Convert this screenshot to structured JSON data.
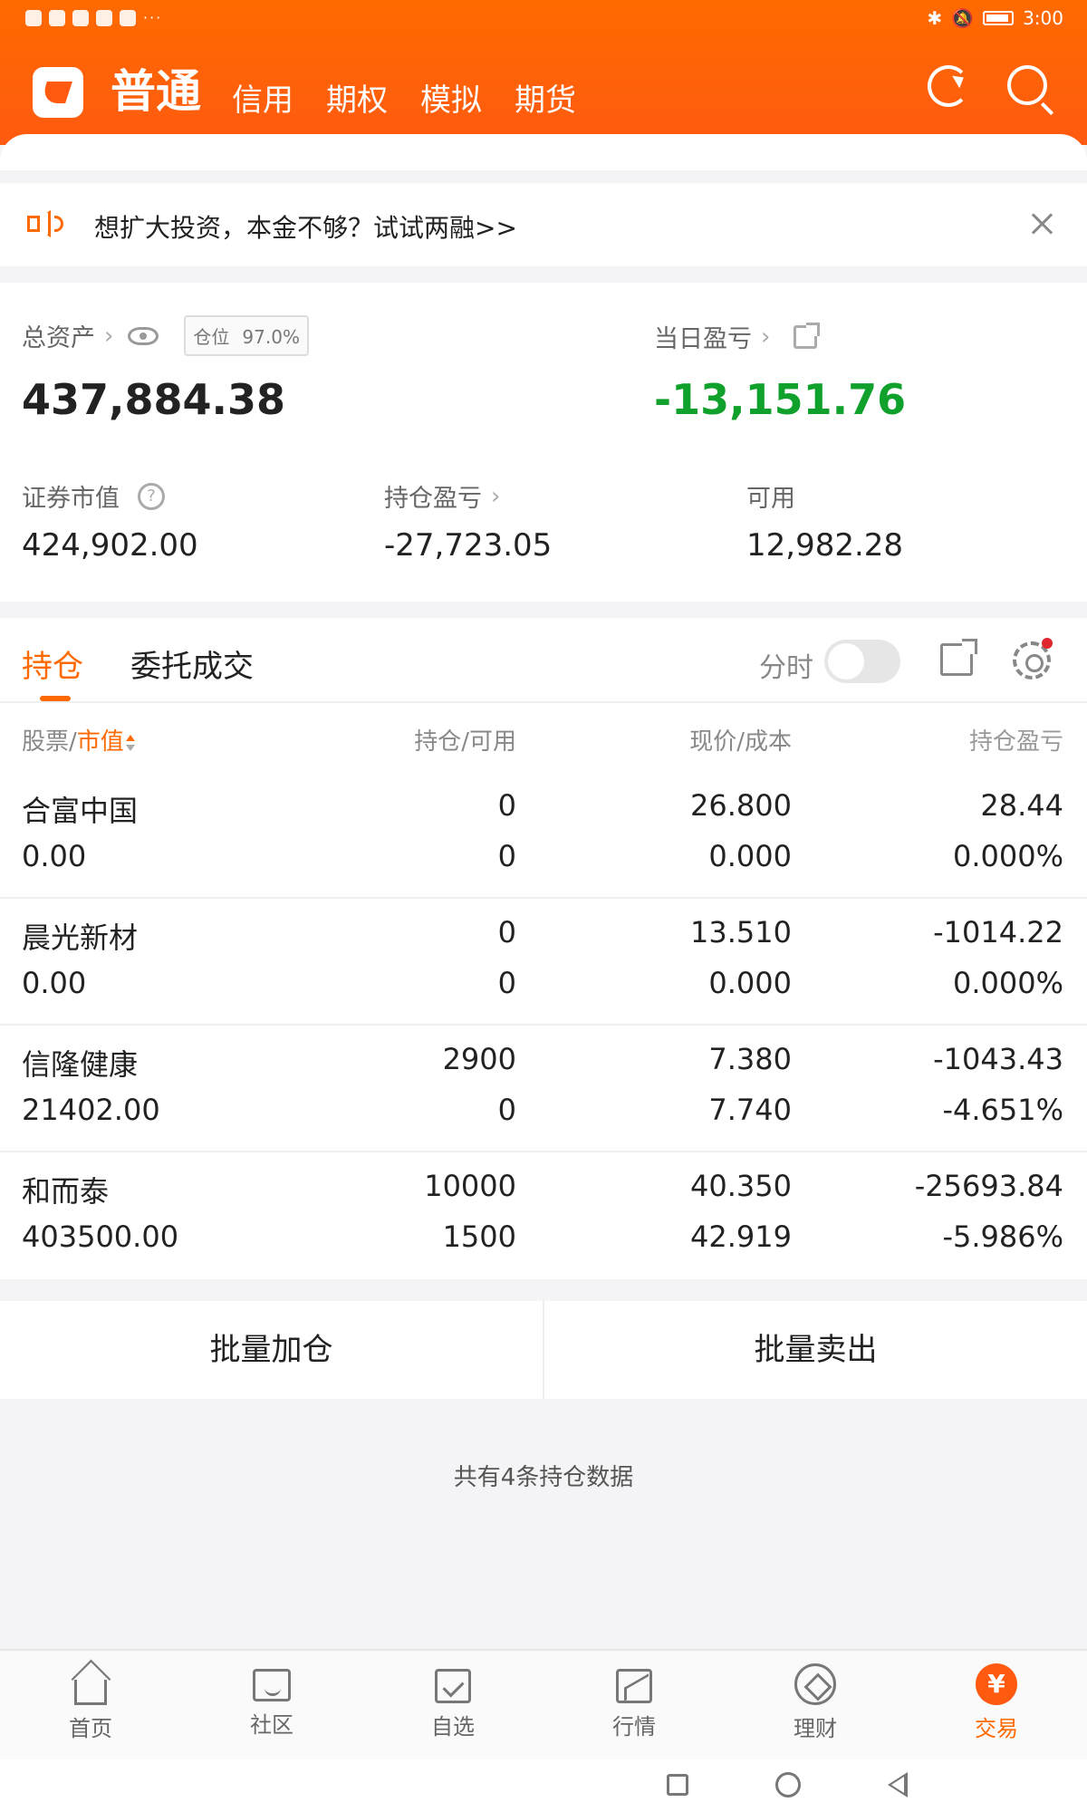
{
  "status_bar": {
    "time": "3:00"
  },
  "header": {
    "main_tab": "普通",
    "tabs": [
      "信用",
      "期权",
      "模拟",
      "期货"
    ]
  },
  "notice": {
    "text": "想扩大投资，本金不够？试试两融>>"
  },
  "assets": {
    "total_label": "总资产",
    "position_label": "仓位",
    "position_value": "97.0%",
    "total_value": "437,884.38",
    "daily_pnl_label": "当日盈亏",
    "daily_pnl_value": "-13,151.76",
    "market_value_label": "证券市值",
    "market_value": "424,902.00",
    "holding_pnl_label": "持仓盈亏",
    "holding_pnl_value": "-27,723.05",
    "available_label": "可用",
    "available_value": "12,982.28"
  },
  "holdings": {
    "tab_active": "持仓",
    "tab_other": "委托成交",
    "time_label": "分时",
    "columns": {
      "stock": "股票",
      "slash": "/",
      "market_value": "市值",
      "qty": "持仓/可用",
      "price": "现价/成本",
      "pnl": "持仓盈亏"
    },
    "rows": [
      {
        "name": "合富中国",
        "value": "0.00",
        "qty": "0",
        "available": "0",
        "price": "26.800",
        "cost": "0.000",
        "pnl": "28.44",
        "pnl_pct": "0.000%",
        "color": "#e0262e"
      },
      {
        "name": "晨光新材",
        "value": "0.00",
        "qty": "0",
        "available": "0",
        "price": "13.510",
        "cost": "0.000",
        "pnl": "-1014.22",
        "pnl_pct": "0.000%",
        "color": "#10a02c"
      },
      {
        "name": "信隆健康",
        "value": "21402.00",
        "qty": "2900",
        "available": "0",
        "price": "7.380",
        "cost": "7.740",
        "pnl": "-1043.43",
        "pnl_pct": "-4.651%",
        "color": "#10a02c"
      },
      {
        "name": "和而泰",
        "value": "403500.00",
        "qty": "10000",
        "available": "1500",
        "price": "40.350",
        "cost": "42.919",
        "pnl": "-25693.84",
        "pnl_pct": "-5.986%",
        "color": "#10a02c"
      }
    ]
  },
  "actions": {
    "batch_add": "批量加仓",
    "batch_sell": "批量卖出"
  },
  "count_text": "共有4条持仓数据",
  "bottom_nav": [
    {
      "label": "首页",
      "icon": "home-icon"
    },
    {
      "label": "社区",
      "icon": "chat-icon"
    },
    {
      "label": "自选",
      "icon": "check-icon"
    },
    {
      "label": "行情",
      "icon": "chart-icon"
    },
    {
      "label": "理财",
      "icon": "diamond-icon"
    },
    {
      "label": "交易",
      "icon": "yuan-icon",
      "glyph": "¥"
    }
  ]
}
